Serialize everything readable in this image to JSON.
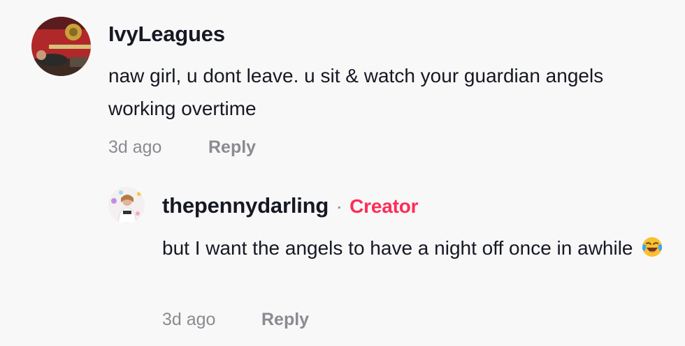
{
  "comments": [
    {
      "username": "IvyLeagues",
      "text": "naw girl, u dont leave. u sit & watch your guardian angels working overtime",
      "time": "3d ago",
      "reply_label": "Reply",
      "avatar_icon": "avatar-photo"
    }
  ],
  "reply": {
    "username": "thepennydarling",
    "separator": "·",
    "badge": "Creator",
    "text": "but I want the angels to have a night off once in awhile",
    "emoji_icon": "face-with-tears-of-joy-icon",
    "time": "3d ago",
    "reply_label": "Reply",
    "avatar_icon": "avatar-photo"
  },
  "colors": {
    "background": "#f8f8f8",
    "text": "#161823",
    "muted": "#8a8b91",
    "creator": "#fe2c55"
  }
}
